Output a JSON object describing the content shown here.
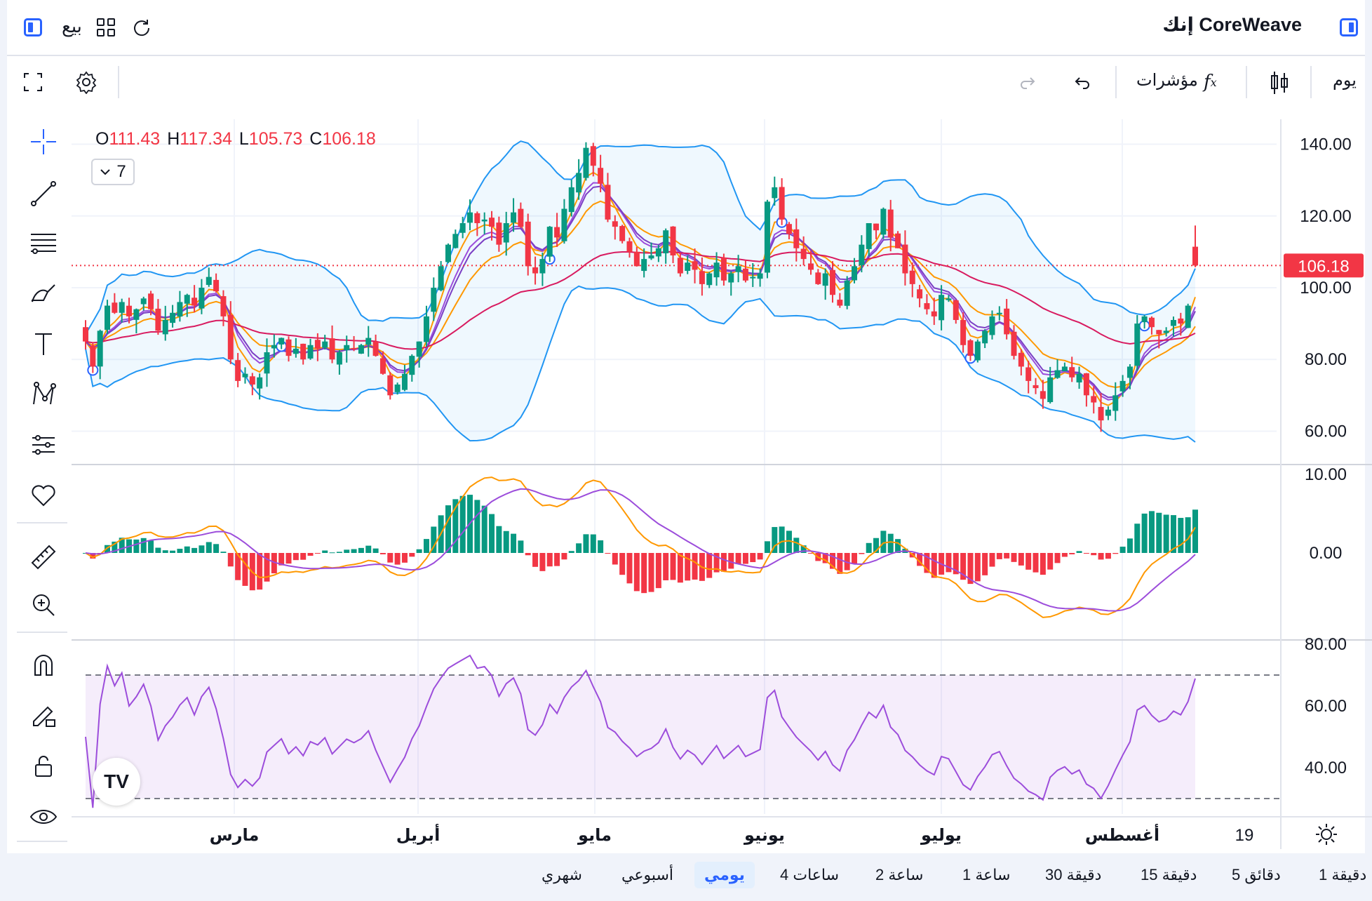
{
  "header": {
    "symbol": "CoreWeave إنك",
    "sell_label": "بيع"
  },
  "toolbar": {
    "interval_label": "يوم",
    "indicators_label": "مؤشرات"
  },
  "legend": {
    "o_label": "O",
    "o_value": "111.43",
    "h_label": "H",
    "h_value": "117.34",
    "l_label": "L",
    "l_value": "105.73",
    "c_label": "C",
    "c_value": "106.18",
    "indicator_count": "7"
  },
  "price_tag": "106.18",
  "axis": {
    "price_ticks": [
      "140.00",
      "120.00",
      "100.00",
      "80.00",
      "60.00"
    ],
    "macd_ticks": [
      "10.00",
      "0.00"
    ],
    "rsi_ticks": [
      "80.00",
      "60.00",
      "40.00"
    ],
    "time_ticks": [
      "مارس",
      "أبريل",
      "مايو",
      "يونيو",
      "يوليو",
      "أغسطس",
      "19"
    ]
  },
  "intervals": [
    "1 دقيقة",
    "5 دقائق",
    "15 دقيقة",
    "30 دقيقة",
    "1 ساعة",
    "2 ساعة",
    "4 ساعات",
    "يومي",
    "أسبوعي",
    "شهري"
  ],
  "active_interval": "يومي",
  "colors": {
    "up": "#089981",
    "down": "#f23645",
    "accent": "#2962ff",
    "bb": "#2196f3",
    "ema_fast": "#ff9800",
    "ema_slow": "#d81b60",
    "purple": "#9c4ddb"
  },
  "chart_data": {
    "type": "candlestick",
    "y_range": [
      55,
      145
    ],
    "last_price": 106.18,
    "closes": [
      85,
      78,
      88,
      95,
      93,
      96,
      92,
      94,
      97,
      94,
      88,
      91,
      93,
      96,
      98,
      95,
      100,
      103,
      99,
      92,
      80,
      74,
      76,
      73,
      75,
      82,
      84,
      86,
      81,
      83,
      80,
      84,
      83,
      85,
      80,
      82,
      84,
      83,
      84,
      86,
      81,
      76,
      70,
      73,
      76,
      81,
      85,
      92,
      100,
      106,
      112,
      115,
      118,
      121,
      118,
      119,
      117,
      112,
      118,
      121,
      117,
      106,
      104,
      108,
      117,
      114,
      122,
      128,
      132,
      139,
      134,
      129,
      119,
      117,
      113,
      110,
      106,
      108,
      109,
      111,
      116,
      109,
      104,
      107,
      105,
      101,
      104,
      107,
      102,
      104,
      106,
      102,
      103,
      104,
      124,
      128,
      119,
      115,
      111,
      108,
      105,
      101,
      104,
      98,
      95,
      102,
      106,
      112,
      118,
      116,
      122,
      114,
      111,
      104,
      101,
      97,
      94,
      92,
      98,
      97,
      91,
      84,
      81,
      85,
      88,
      92,
      93,
      87,
      81,
      78,
      74,
      72,
      69,
      75,
      77,
      78,
      75,
      76,
      70,
      68,
      63,
      66,
      70,
      74,
      78,
      90,
      92,
      89,
      87,
      88,
      91,
      90,
      95,
      106.18
    ]
  }
}
